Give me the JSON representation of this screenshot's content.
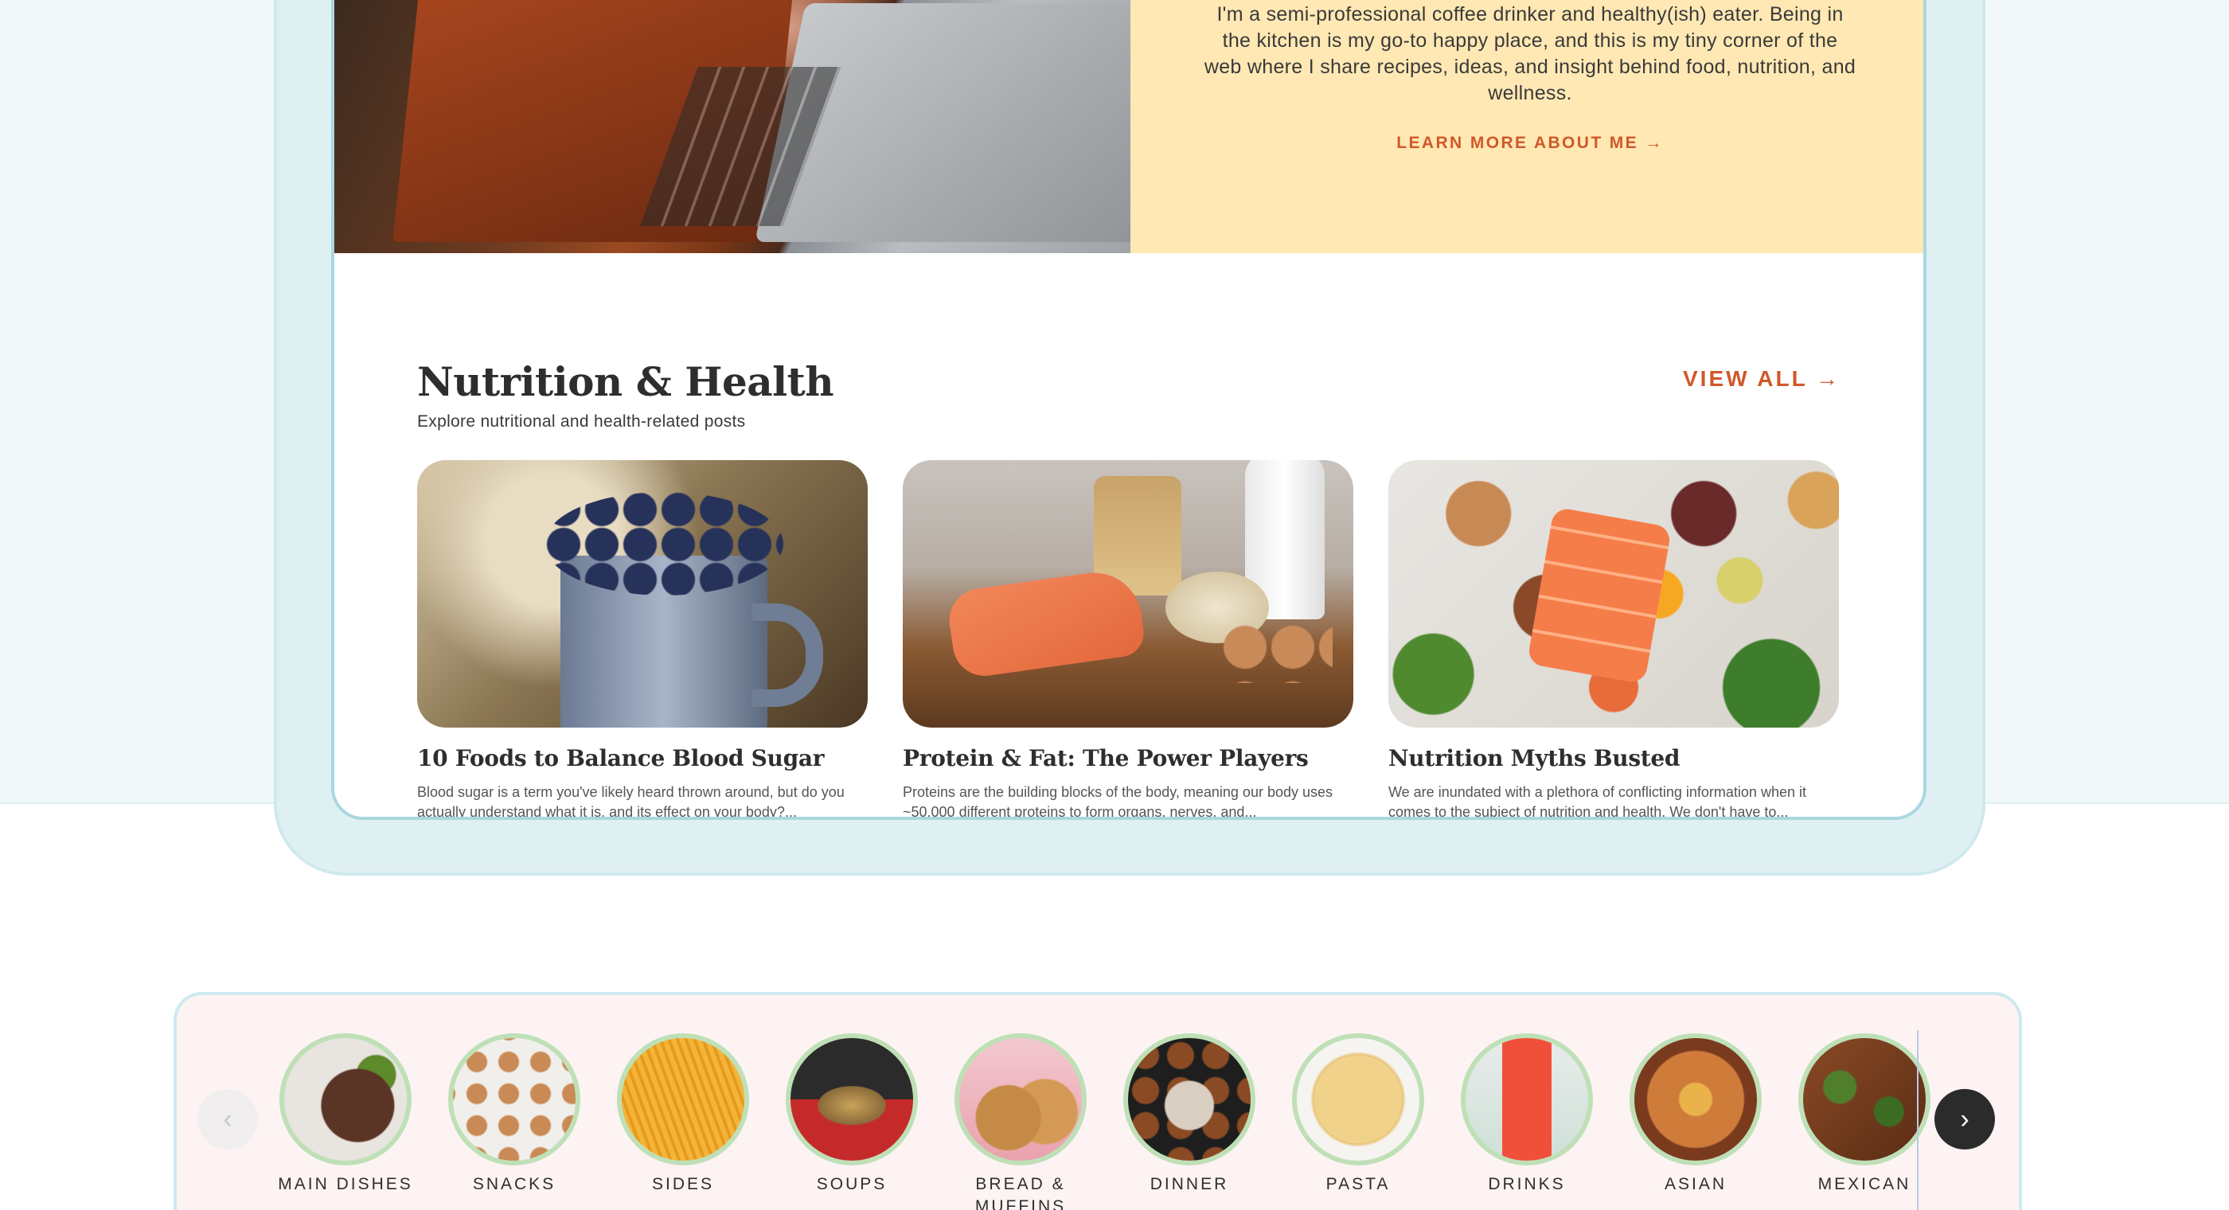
{
  "about": {
    "text": "I'm a semi-professional coffee drinker and healthy(ish) eater. Being in the kitchen is my go-to happy place, and this is my tiny corner of the web where I share recipes, ideas, and insight behind food, nutrition, and wellness.",
    "link": "LEARN MORE ABOUT ME →"
  },
  "section": {
    "title": "Nutrition & Health",
    "subtitle": "Explore nutritional and health-related posts",
    "view_all": "VIEW ALL →"
  },
  "posts": [
    {
      "title": "10 Foods to Balance Blood Sugar",
      "excerpt": "Blood sugar is a term you've likely heard thrown around, but do you actually understand what it is, and its effect on your body?..."
    },
    {
      "title": "Protein & Fat: The Power Players",
      "excerpt": "Proteins are the building blocks of the body, meaning our body uses ~50,000 different proteins to form organs, nerves, and..."
    },
    {
      "title": "Nutrition Myths Busted",
      "excerpt": "We are inundated with a plethora of conflicting information when it comes to the subject of nutrition and health. We don't have to..."
    }
  ],
  "categories": [
    {
      "label": "MAIN DISHES"
    },
    {
      "label": "SNACKS"
    },
    {
      "label": "SIDES"
    },
    {
      "label": "SOUPS"
    },
    {
      "label": "BREAD & MUFFINS"
    },
    {
      "label": "DINNER"
    },
    {
      "label": "PASTA"
    },
    {
      "label": "DRINKS"
    },
    {
      "label": "ASIAN"
    },
    {
      "label": "MEXICAN"
    }
  ],
  "carousel": {
    "prev_icon": "chevron-left-icon",
    "next_icon": "chevron-right-icon"
  },
  "colors": {
    "accent": "#d0582a",
    "about_bg": "#ffe8b3",
    "frame": "#a9d7e0",
    "category_bg": "#fdf3f3"
  }
}
